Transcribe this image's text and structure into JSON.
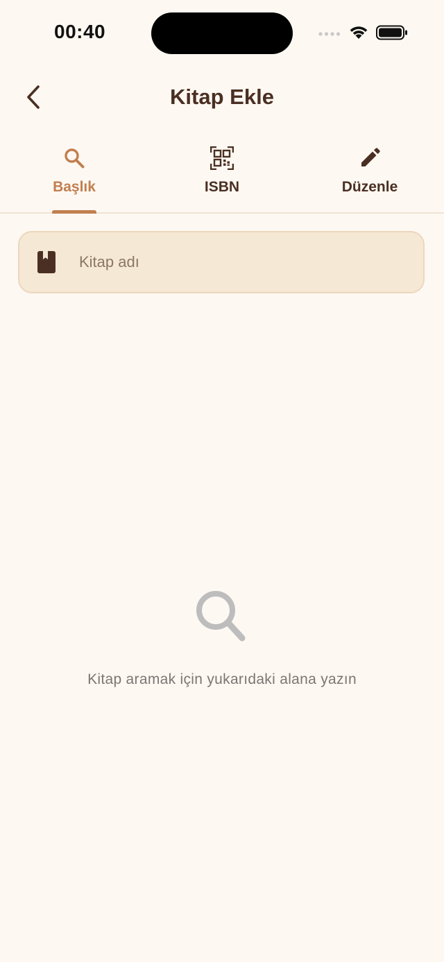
{
  "status_bar": {
    "time": "00:40"
  },
  "header": {
    "title": "Kitap Ekle"
  },
  "tabs": [
    {
      "label": "Başlık",
      "icon": "search-icon",
      "active": true
    },
    {
      "label": "ISBN",
      "icon": "qr-code-icon",
      "active": false
    },
    {
      "label": "Düzenle",
      "icon": "pencil-icon",
      "active": false
    }
  ],
  "search": {
    "placeholder": "Kitap adı",
    "value": ""
  },
  "empty_state": {
    "icon": "search-icon",
    "message": "Kitap aramak için yukarıdaki alana yazın"
  },
  "colors": {
    "background": "#fdf8f2",
    "accent": "#c17f4f",
    "text_dark": "#4a2f22",
    "field_bg": "#f5e8d5",
    "muted": "#7b7672"
  }
}
